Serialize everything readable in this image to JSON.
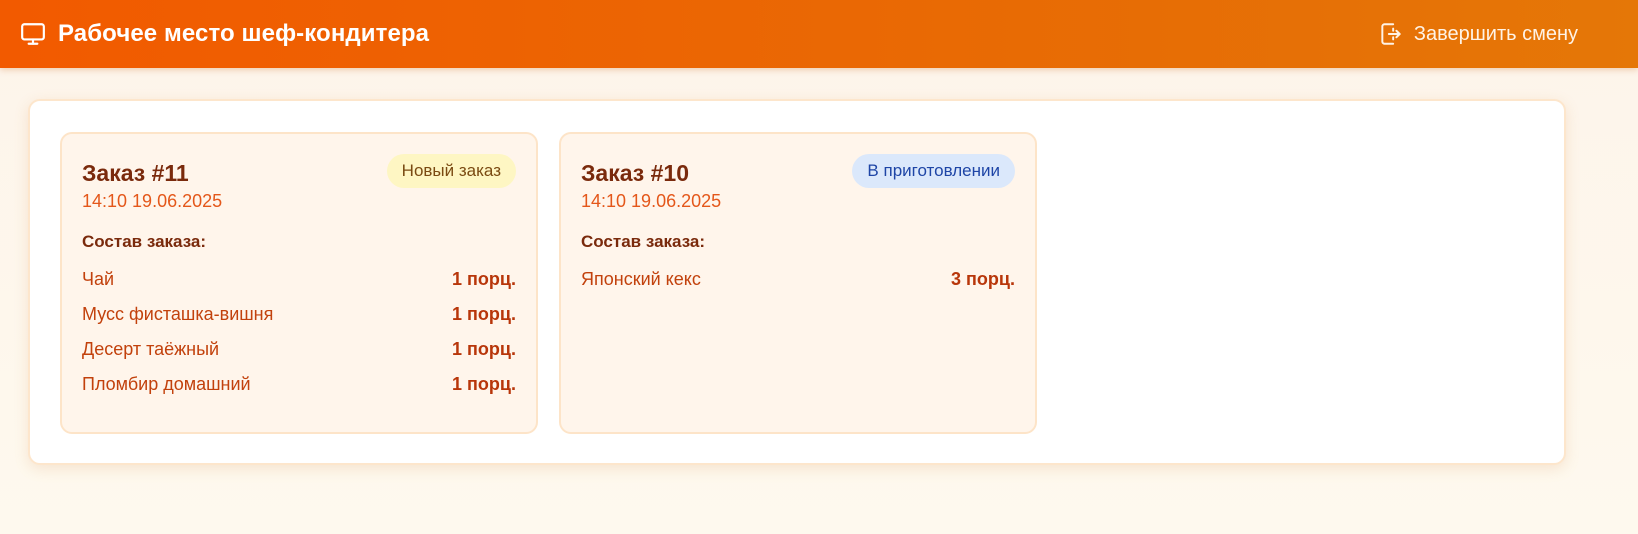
{
  "header": {
    "title": "Рабочее место шеф-кондитера",
    "logout_label": "Завершить смену",
    "icons": {
      "brand": "monitor-icon",
      "logout": "logout-icon"
    }
  },
  "colors": {
    "header_start": "#f25a00",
    "header_end": "#e57707",
    "new_badge_bg": "#fef6c3",
    "cooking_badge_bg": "#dbe8fb"
  },
  "orders": [
    {
      "title": "Заказ #11",
      "status": "Новый заказ",
      "time": "14:10 19.06.2025",
      "composition_label": "Состав заказа:",
      "items": [
        {
          "name": "Чай",
          "qty": "1 порц."
        },
        {
          "name": "Мусс фисташка-вишня",
          "qty": "1 порц."
        },
        {
          "name": "Десерт таёжный",
          "qty": "1 порц."
        },
        {
          "name": "Пломбир домашний",
          "qty": "1 порц."
        }
      ]
    },
    {
      "title": "Заказ #10",
      "status": "В приготовлении",
      "time": "14:10 19.06.2025",
      "composition_label": "Состав заказа:",
      "items": [
        {
          "name": "Японский кекс",
          "qty": "3 порц."
        }
      ]
    }
  ]
}
